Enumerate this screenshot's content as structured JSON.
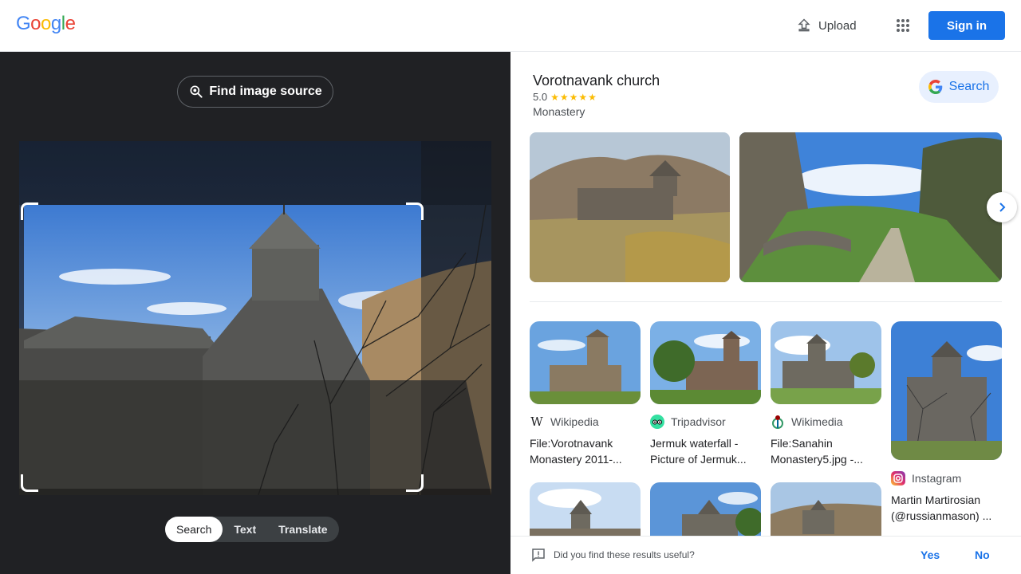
{
  "header": {
    "logo_letters": [
      "G",
      "o",
      "o",
      "g",
      "l",
      "e"
    ],
    "logo_colors": [
      "#4285f4",
      "#ea4335",
      "#fbbc05",
      "#4285f4",
      "#34a853",
      "#ea4335"
    ],
    "upload_label": "Upload",
    "signin_label": "Sign in"
  },
  "lens": {
    "find_source_label": "Find image source",
    "modes": [
      "Search",
      "Text",
      "Translate"
    ],
    "active_mode": "Search"
  },
  "knowledge_panel": {
    "title": "Vorotnavank church",
    "rating": "5.0",
    "stars": "★★★★★",
    "subtitle": "Monastery",
    "search_label": "Search"
  },
  "results": [
    {
      "source": "Wikipedia",
      "source_icon": "wikipedia-icon",
      "title_line1": "File:Vorotnavank",
      "title_line2": "Monastery 2011-..."
    },
    {
      "source": "Tripadvisor",
      "source_icon": "tripadvisor-icon",
      "title_line1": "Jermuk waterfall -",
      "title_line2": "Picture of Jermuk..."
    },
    {
      "source": "Wikimedia",
      "source_icon": "wikimedia-icon",
      "title_line1": "File:Sanahin",
      "title_line2": "Monastery5.jpg -..."
    },
    {
      "source": "Instagram",
      "source_icon": "instagram-icon",
      "title_line1": "Martin Martirosian",
      "title_line2": "(@russianmason) ..."
    }
  ],
  "feedback": {
    "question": "Did you find these results useful?",
    "yes_label": "Yes",
    "no_label": "No"
  },
  "colors": {
    "accent": "#1a73e8",
    "dark_panel": "#202124",
    "star": "#fbbc04"
  }
}
